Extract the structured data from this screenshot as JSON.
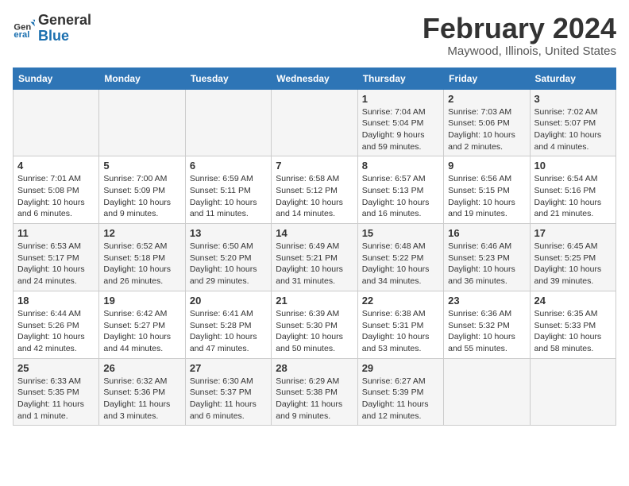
{
  "header": {
    "logo_line1": "General",
    "logo_line2": "Blue",
    "month": "February 2024",
    "location": "Maywood, Illinois, United States"
  },
  "weekdays": [
    "Sunday",
    "Monday",
    "Tuesday",
    "Wednesday",
    "Thursday",
    "Friday",
    "Saturday"
  ],
  "weeks": [
    [
      {
        "day": "",
        "sunrise": "",
        "sunset": "",
        "daylight": ""
      },
      {
        "day": "",
        "sunrise": "",
        "sunset": "",
        "daylight": ""
      },
      {
        "day": "",
        "sunrise": "",
        "sunset": "",
        "daylight": ""
      },
      {
        "day": "",
        "sunrise": "",
        "sunset": "",
        "daylight": ""
      },
      {
        "day": "1",
        "sunrise": "Sunrise: 7:04 AM",
        "sunset": "Sunset: 5:04 PM",
        "daylight": "Daylight: 9 hours and 59 minutes."
      },
      {
        "day": "2",
        "sunrise": "Sunrise: 7:03 AM",
        "sunset": "Sunset: 5:06 PM",
        "daylight": "Daylight: 10 hours and 2 minutes."
      },
      {
        "day": "3",
        "sunrise": "Sunrise: 7:02 AM",
        "sunset": "Sunset: 5:07 PM",
        "daylight": "Daylight: 10 hours and 4 minutes."
      }
    ],
    [
      {
        "day": "4",
        "sunrise": "Sunrise: 7:01 AM",
        "sunset": "Sunset: 5:08 PM",
        "daylight": "Daylight: 10 hours and 6 minutes."
      },
      {
        "day": "5",
        "sunrise": "Sunrise: 7:00 AM",
        "sunset": "Sunset: 5:09 PM",
        "daylight": "Daylight: 10 hours and 9 minutes."
      },
      {
        "day": "6",
        "sunrise": "Sunrise: 6:59 AM",
        "sunset": "Sunset: 5:11 PM",
        "daylight": "Daylight: 10 hours and 11 minutes."
      },
      {
        "day": "7",
        "sunrise": "Sunrise: 6:58 AM",
        "sunset": "Sunset: 5:12 PM",
        "daylight": "Daylight: 10 hours and 14 minutes."
      },
      {
        "day": "8",
        "sunrise": "Sunrise: 6:57 AM",
        "sunset": "Sunset: 5:13 PM",
        "daylight": "Daylight: 10 hours and 16 minutes."
      },
      {
        "day": "9",
        "sunrise": "Sunrise: 6:56 AM",
        "sunset": "Sunset: 5:15 PM",
        "daylight": "Daylight: 10 hours and 19 minutes."
      },
      {
        "day": "10",
        "sunrise": "Sunrise: 6:54 AM",
        "sunset": "Sunset: 5:16 PM",
        "daylight": "Daylight: 10 hours and 21 minutes."
      }
    ],
    [
      {
        "day": "11",
        "sunrise": "Sunrise: 6:53 AM",
        "sunset": "Sunset: 5:17 PM",
        "daylight": "Daylight: 10 hours and 24 minutes."
      },
      {
        "day": "12",
        "sunrise": "Sunrise: 6:52 AM",
        "sunset": "Sunset: 5:18 PM",
        "daylight": "Daylight: 10 hours and 26 minutes."
      },
      {
        "day": "13",
        "sunrise": "Sunrise: 6:50 AM",
        "sunset": "Sunset: 5:20 PM",
        "daylight": "Daylight: 10 hours and 29 minutes."
      },
      {
        "day": "14",
        "sunrise": "Sunrise: 6:49 AM",
        "sunset": "Sunset: 5:21 PM",
        "daylight": "Daylight: 10 hours and 31 minutes."
      },
      {
        "day": "15",
        "sunrise": "Sunrise: 6:48 AM",
        "sunset": "Sunset: 5:22 PM",
        "daylight": "Daylight: 10 hours and 34 minutes."
      },
      {
        "day": "16",
        "sunrise": "Sunrise: 6:46 AM",
        "sunset": "Sunset: 5:23 PM",
        "daylight": "Daylight: 10 hours and 36 minutes."
      },
      {
        "day": "17",
        "sunrise": "Sunrise: 6:45 AM",
        "sunset": "Sunset: 5:25 PM",
        "daylight": "Daylight: 10 hours and 39 minutes."
      }
    ],
    [
      {
        "day": "18",
        "sunrise": "Sunrise: 6:44 AM",
        "sunset": "Sunset: 5:26 PM",
        "daylight": "Daylight: 10 hours and 42 minutes."
      },
      {
        "day": "19",
        "sunrise": "Sunrise: 6:42 AM",
        "sunset": "Sunset: 5:27 PM",
        "daylight": "Daylight: 10 hours and 44 minutes."
      },
      {
        "day": "20",
        "sunrise": "Sunrise: 6:41 AM",
        "sunset": "Sunset: 5:28 PM",
        "daylight": "Daylight: 10 hours and 47 minutes."
      },
      {
        "day": "21",
        "sunrise": "Sunrise: 6:39 AM",
        "sunset": "Sunset: 5:30 PM",
        "daylight": "Daylight: 10 hours and 50 minutes."
      },
      {
        "day": "22",
        "sunrise": "Sunrise: 6:38 AM",
        "sunset": "Sunset: 5:31 PM",
        "daylight": "Daylight: 10 hours and 53 minutes."
      },
      {
        "day": "23",
        "sunrise": "Sunrise: 6:36 AM",
        "sunset": "Sunset: 5:32 PM",
        "daylight": "Daylight: 10 hours and 55 minutes."
      },
      {
        "day": "24",
        "sunrise": "Sunrise: 6:35 AM",
        "sunset": "Sunset: 5:33 PM",
        "daylight": "Daylight: 10 hours and 58 minutes."
      }
    ],
    [
      {
        "day": "25",
        "sunrise": "Sunrise: 6:33 AM",
        "sunset": "Sunset: 5:35 PM",
        "daylight": "Daylight: 11 hours and 1 minute."
      },
      {
        "day": "26",
        "sunrise": "Sunrise: 6:32 AM",
        "sunset": "Sunset: 5:36 PM",
        "daylight": "Daylight: 11 hours and 3 minutes."
      },
      {
        "day": "27",
        "sunrise": "Sunrise: 6:30 AM",
        "sunset": "Sunset: 5:37 PM",
        "daylight": "Daylight: 11 hours and 6 minutes."
      },
      {
        "day": "28",
        "sunrise": "Sunrise: 6:29 AM",
        "sunset": "Sunset: 5:38 PM",
        "daylight": "Daylight: 11 hours and 9 minutes."
      },
      {
        "day": "29",
        "sunrise": "Sunrise: 6:27 AM",
        "sunset": "Sunset: 5:39 PM",
        "daylight": "Daylight: 11 hours and 12 minutes."
      },
      {
        "day": "",
        "sunrise": "",
        "sunset": "",
        "daylight": ""
      },
      {
        "day": "",
        "sunrise": "",
        "sunset": "",
        "daylight": ""
      }
    ]
  ]
}
